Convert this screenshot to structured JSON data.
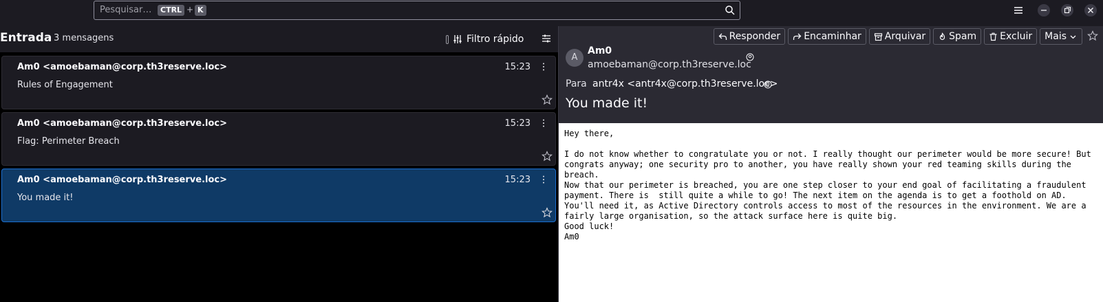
{
  "search": {
    "placeholder": "Pesquisar…",
    "key1": "CTRL",
    "plus": "+",
    "key2": "K"
  },
  "folder": {
    "title": "Entrada",
    "count": "3 mensagens",
    "quick_filter": "Filtro rápido"
  },
  "messages": [
    {
      "sender": "Am0 <amoebaman@corp.th3reserve.loc>",
      "subject": "Rules of Engagement",
      "time": "15:23",
      "selected": false
    },
    {
      "sender": "Am0 <amoebaman@corp.th3reserve.loc>",
      "subject": "Flag: Perimeter Breach",
      "time": "15:23",
      "selected": false
    },
    {
      "sender": "Am0 <amoebaman@corp.th3reserve.loc>",
      "subject": "You made it!",
      "time": "15:23",
      "selected": true
    }
  ],
  "toolbar": {
    "reply": "Responder",
    "forward": "Encaminhar",
    "archive": "Arquivar",
    "spam": "Spam",
    "delete": "Excluir",
    "more": "Mais"
  },
  "reader": {
    "avatar_letter": "A",
    "from_name": "Am0",
    "from_email": "amoebaman@corp.th3reserve.loc",
    "to_label": "Para",
    "to_value": "antr4x <antr4x@corp.th3reserve.loc>",
    "subject": "You made it!",
    "body": "Hey there,\n\nI do not know whether to congratulate you or not. I really thought our perimeter would be more secure! But\ncongrats anyway; one security pro to another, you have really shown your red teaming skills during the\nbreach.\nNow that our perimeter is breached, you are one step closer to your end goal of facilitating a fraudulent\npayment. There is  still quite a while to go! The next item on the agenda is to get a foothold on AD.\nYou'll need it, as Active Directory controls access to most of the resources in the environment. We are a\nfairly large organisation, so the attack surface here is quite big.\nGood luck!\nAm0"
  },
  "colors": {
    "accent": "#1b6fd1",
    "selected_bg": "#0f3a66",
    "pane_bg": "#2b2a33",
    "list_bg": "#000000"
  }
}
